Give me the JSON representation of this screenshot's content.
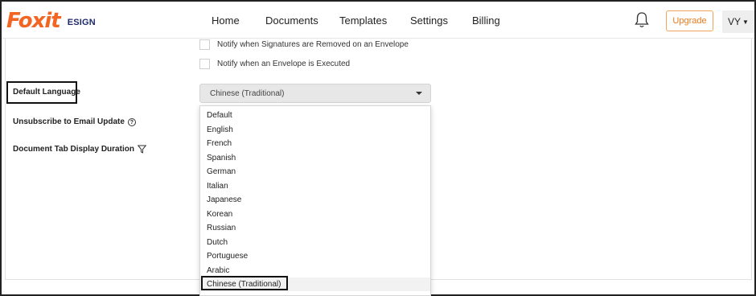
{
  "brand": {
    "logo_text": "Foxit",
    "product": "ESIGN",
    "accent": "#f26522",
    "navy": "#1f2a6b"
  },
  "nav": {
    "items": [
      {
        "label": "Home"
      },
      {
        "label": "Documents"
      },
      {
        "label": "Templates"
      },
      {
        "label": "Settings"
      },
      {
        "label": "Billing"
      }
    ]
  },
  "header": {
    "bell_icon": "bell-icon",
    "upgrade_label": "Upgrade",
    "user_initials": "VY"
  },
  "settings": {
    "notify_removed": "Notify when Signatures are Removed on an Envelope",
    "notify_executed": "Notify when an Envelope is Executed",
    "default_language_label": "Default Language",
    "unsubscribe_label": "Unsubscribe to Email Update",
    "doc_tab_label": "Document Tab Display Duration",
    "language_value": "Chinese (Traditional)"
  },
  "language_options": [
    "Default",
    "English",
    "French",
    "Spanish",
    "German",
    "Italian",
    "Japanese",
    "Korean",
    "Russian",
    "Dutch",
    "Portuguese",
    "Arabic",
    "Chinese (Traditional)"
  ],
  "selected_option_index": 12
}
